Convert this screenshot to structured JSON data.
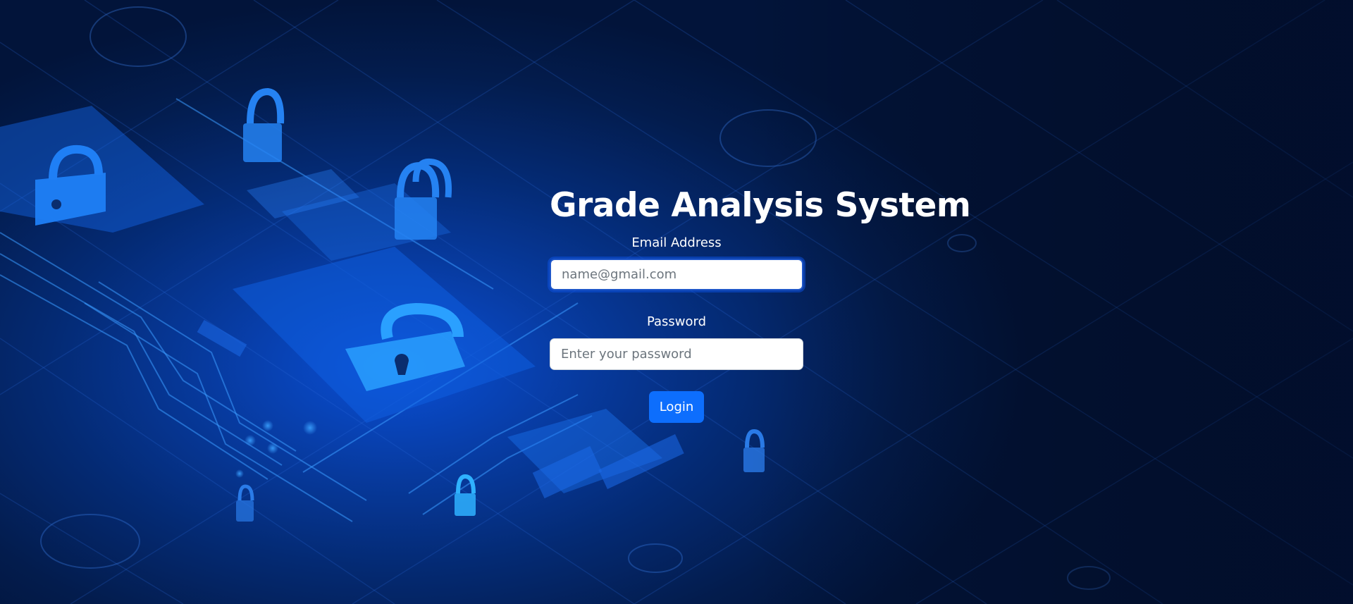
{
  "login": {
    "title": "Grade Analysis System",
    "email_label": "Email Address",
    "email_placeholder": "name@gmail.com",
    "email_value": "",
    "password_label": "Password",
    "password_placeholder": "Enter your password",
    "password_value": "",
    "submit_label": "Login"
  },
  "background": {
    "theme": "cybersecurity circuit board with padlock icons",
    "icons": [
      "padlock-icon",
      "circuit-lines"
    ],
    "colors": {
      "primary_bg": "#031c4d",
      "glow": "#0a4fd6",
      "accent": "#0d6efd"
    }
  }
}
